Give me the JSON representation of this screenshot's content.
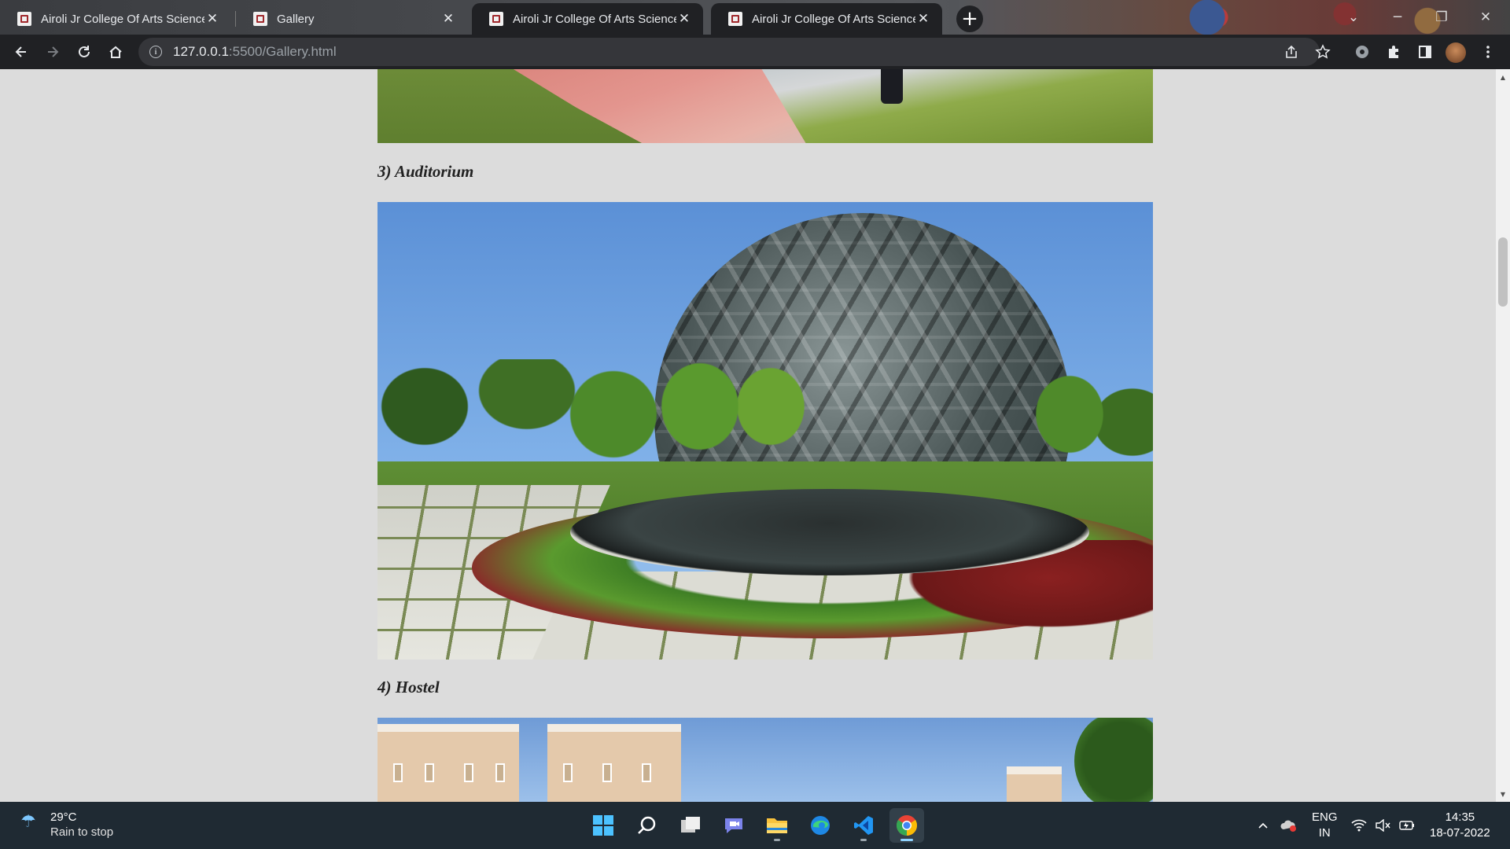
{
  "browser": {
    "tabs": [
      {
        "title": "Airoli Jr College Of Arts Science /",
        "active": false
      },
      {
        "title": "Gallery",
        "active": true
      },
      {
        "title": "Airoli Jr College Of Arts Science /",
        "active": false
      },
      {
        "title": "Airoli Jr College Of Arts Science /",
        "active": false
      }
    ],
    "url_host": "127.0.0.1",
    "url_rest": ":5500/Gallery.html"
  },
  "gallery": {
    "captions": [
      "3) Auditorium",
      "4) Hostel"
    ]
  },
  "taskbar": {
    "weather_temp": "29°C",
    "weather_condition": "Rain to stop",
    "language_top": "ENG",
    "language_bottom": "IN",
    "time": "14:35",
    "date": "18-07-2022"
  },
  "icons": {
    "accent": "#8fd3ff",
    "chrome_dark": "#202124"
  }
}
